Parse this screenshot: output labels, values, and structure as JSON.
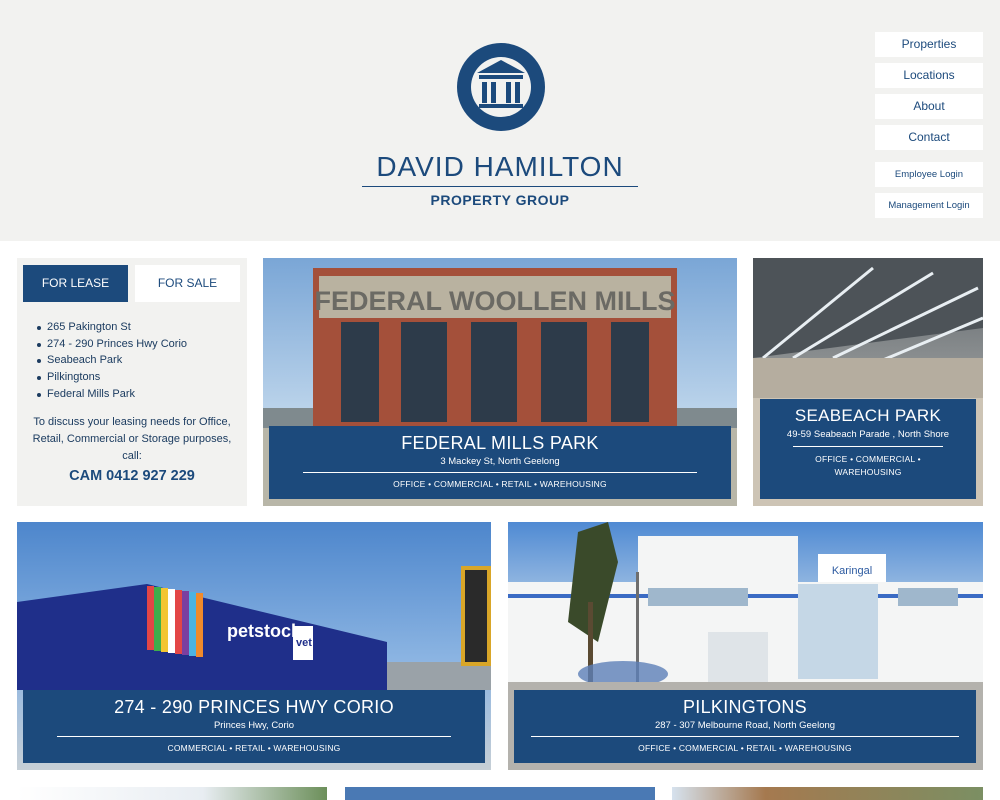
{
  "brand": {
    "name": "DAVID HAMILTON",
    "subtitle": "PROPERTY GROUP",
    "icon": "building-columns-icon",
    "color": "#1c4a7c"
  },
  "nav": {
    "properties": "Properties",
    "locations": "Locations",
    "about": "About",
    "contact": "Contact",
    "employee_login": "Employee Login",
    "management_login": "Management Login"
  },
  "lease_panel": {
    "tab_lease": "FOR LEASE",
    "tab_sale": "FOR SALE",
    "items": [
      "265 Pakington St",
      "274 - 290 Princes Hwy Corio",
      "Seabeach Park",
      "Pilkingtons",
      "Federal Mills Park"
    ],
    "message": "To discuss your leasing needs for Office, Retail, Commercial or Storage purposes, call:",
    "phone": "CAM 0412 927 229"
  },
  "properties": [
    {
      "title": "FEDERAL MILLS PARK",
      "address": "3 Mackey St, North Geelong",
      "tags": "OFFICE • COMMERCIAL • RETAIL • WAREHOUSING"
    },
    {
      "title": "SEABEACH PARK",
      "address": "49-59 Seabeach Parade , North Shore",
      "tags": "OFFICE • COMMERCIAL • WAREHOUSING"
    },
    {
      "title": "274 - 290 PRINCES HWY CORIO",
      "address": "Princes Hwy, Corio",
      "tags": "COMMERCIAL • RETAIL • WAREHOUSING"
    },
    {
      "title": "PILKINGTONS",
      "address": "287 - 307 Melbourne Road, North Geelong",
      "tags": "OFFICE • COMMERCIAL • RETAIL • WAREHOUSING"
    }
  ],
  "photo_text": {
    "mills_sign": "FEDERAL WOOLLEN MILLS",
    "petstock": "petstock",
    "vet": "vet",
    "karingal": "Karingal"
  }
}
